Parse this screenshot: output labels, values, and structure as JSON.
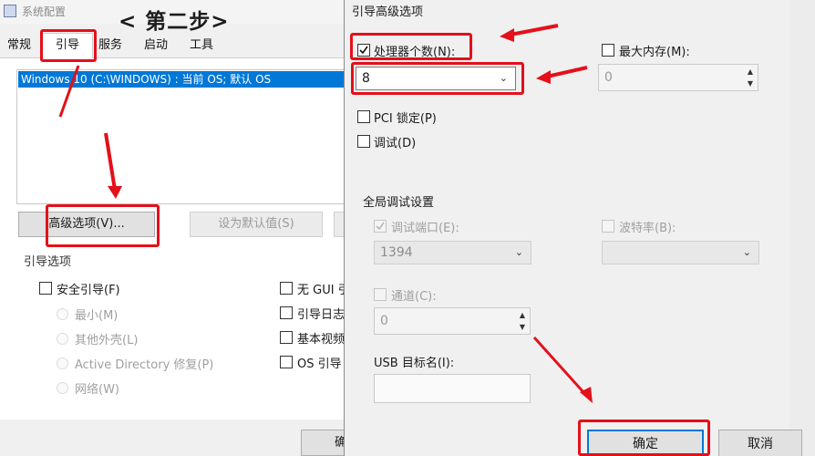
{
  "background_window": {
    "title": "系统配置",
    "tabs": [
      {
        "label": "常规"
      },
      {
        "label": "引导"
      },
      {
        "label": "服务"
      },
      {
        "label": "启动"
      },
      {
        "label": "工具"
      }
    ],
    "os_entry": "Windows 10 (C:\\WINDOWS) : 当前 OS; 默认 OS",
    "advanced_button": "高级选项(V)...",
    "set_default_button": "设为默认值(S)",
    "boot_options_title": "引导选项",
    "safe_boot": "安全引导(F)",
    "radios": [
      {
        "label": "最小(M)"
      },
      {
        "label": "其他外壳(L)"
      },
      {
        "label": "Active Directory 修复(P)"
      },
      {
        "label": "网络(W)"
      }
    ],
    "right_checks": [
      {
        "label": "无 GUI 引"
      },
      {
        "label": "引导日志"
      },
      {
        "label": "基本视频"
      },
      {
        "label": "OS 引导"
      }
    ],
    "ok_partial": "确"
  },
  "annotation": {
    "step_label": "< 第二步>",
    "highlight_color": "#e4101a"
  },
  "dialog": {
    "title": "引导高级选项",
    "num_processors_label": "处理器个数(N):",
    "num_processors_checked": true,
    "num_processors_value": "8",
    "max_memory_label": "最大内存(M):",
    "max_memory_value": "0",
    "pci_lock_label": "PCI 锁定(P)",
    "debug_label": "调试(D)",
    "global_debug_title": "全局调试设置",
    "debug_port_label": "调试端口(E):",
    "debug_port_value": "1394",
    "baud_rate_label": "波特率(B):",
    "channel_label": "通道(C):",
    "channel_value": "0",
    "usb_target_label": "USB 目标名(I):",
    "ok_button": "确定",
    "cancel_button": "取消"
  }
}
